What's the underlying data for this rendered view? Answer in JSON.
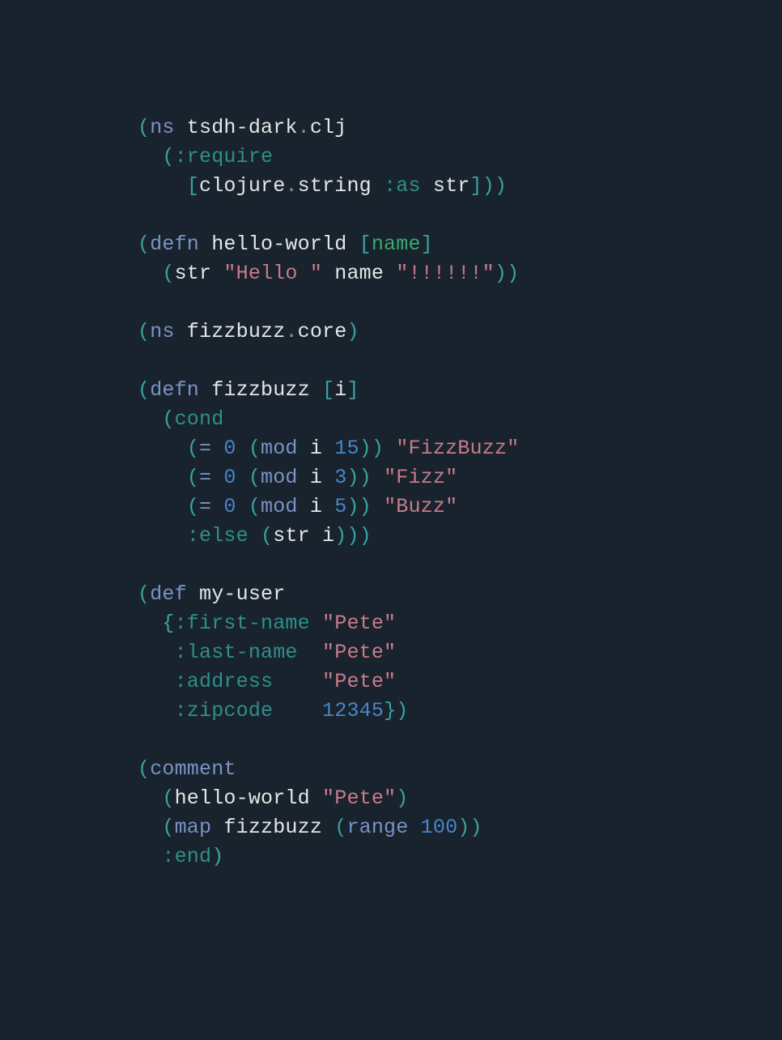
{
  "theme": {
    "bg": "#18232e",
    "fg": "#e6e6e6",
    "paren": "#3aa39f",
    "bracket": "#3aa39f",
    "brace": "#3aa39f",
    "keyword_builtin": "#7b92c5",
    "keyword_teal": "#2f8f8a",
    "string": "#c97b88",
    "number": "#4a85c9",
    "symbol_green": "#3aa86e",
    "gray": "#8a9099"
  },
  "code": {
    "tokens": [
      [
        [
          "(",
          "paren"
        ],
        [
          "ns",
          "builtin"
        ],
        [
          " tsdh-dark",
          "fg"
        ],
        [
          ".",
          "gray"
        ],
        [
          "clj",
          "fg"
        ]
      ],
      [
        [
          "  ",
          "fg"
        ],
        [
          "(",
          "paren"
        ],
        [
          ":require",
          "kw"
        ]
      ],
      [
        [
          "    ",
          "fg"
        ],
        [
          "[",
          "bracket"
        ],
        [
          "clojure",
          "fg"
        ],
        [
          ".",
          "gray"
        ],
        [
          "string ",
          "fg"
        ],
        [
          ":as",
          "kw"
        ],
        [
          " str",
          "fg"
        ],
        [
          "]",
          "bracket"
        ],
        [
          ")",
          "paren"
        ],
        [
          ")",
          "paren"
        ]
      ],
      [
        [
          "",
          "fg"
        ]
      ],
      [
        [
          "(",
          "paren"
        ],
        [
          "defn",
          "builtin"
        ],
        [
          " hello-world ",
          "fg"
        ],
        [
          "[",
          "bracket"
        ],
        [
          "name",
          "green"
        ],
        [
          "]",
          "bracket"
        ]
      ],
      [
        [
          "  ",
          "fg"
        ],
        [
          "(",
          "paren"
        ],
        [
          "str ",
          "fg"
        ],
        [
          "\"Hello \"",
          "string"
        ],
        [
          " name ",
          "fg"
        ],
        [
          "\"!!!!!!\"",
          "string"
        ],
        [
          ")",
          "paren"
        ],
        [
          ")",
          "paren"
        ]
      ],
      [
        [
          "",
          "fg"
        ]
      ],
      [
        [
          "(",
          "paren"
        ],
        [
          "ns",
          "builtin"
        ],
        [
          " fizzbuzz",
          "fg"
        ],
        [
          ".",
          "gray"
        ],
        [
          "core",
          "fg"
        ],
        [
          ")",
          "paren"
        ]
      ],
      [
        [
          "",
          "fg"
        ]
      ],
      [
        [
          "(",
          "paren"
        ],
        [
          "defn",
          "builtin"
        ],
        [
          " fizzbuzz ",
          "fg"
        ],
        [
          "[",
          "bracket"
        ],
        [
          "i",
          "fg"
        ],
        [
          "]",
          "bracket"
        ]
      ],
      [
        [
          "  ",
          "fg"
        ],
        [
          "(",
          "paren"
        ],
        [
          "cond",
          "kw"
        ]
      ],
      [
        [
          "    ",
          "fg"
        ],
        [
          "(",
          "paren"
        ],
        [
          "= ",
          "builtin"
        ],
        [
          "0",
          "number"
        ],
        [
          " ",
          "fg"
        ],
        [
          "(",
          "paren"
        ],
        [
          "mod",
          "builtin"
        ],
        [
          " i ",
          "fg"
        ],
        [
          "15",
          "number"
        ],
        [
          ")",
          "paren"
        ],
        [
          ")",
          "paren"
        ],
        [
          " ",
          "fg"
        ],
        [
          "\"FizzBuzz\"",
          "string"
        ]
      ],
      [
        [
          "    ",
          "fg"
        ],
        [
          "(",
          "paren"
        ],
        [
          "= ",
          "builtin"
        ],
        [
          "0",
          "number"
        ],
        [
          " ",
          "fg"
        ],
        [
          "(",
          "paren"
        ],
        [
          "mod",
          "builtin"
        ],
        [
          " i ",
          "fg"
        ],
        [
          "3",
          "number"
        ],
        [
          ")",
          "paren"
        ],
        [
          ")",
          "paren"
        ],
        [
          " ",
          "fg"
        ],
        [
          "\"Fizz\"",
          "string"
        ]
      ],
      [
        [
          "    ",
          "fg"
        ],
        [
          "(",
          "paren"
        ],
        [
          "= ",
          "builtin"
        ],
        [
          "0",
          "number"
        ],
        [
          " ",
          "fg"
        ],
        [
          "(",
          "paren"
        ],
        [
          "mod",
          "builtin"
        ],
        [
          " i ",
          "fg"
        ],
        [
          "5",
          "number"
        ],
        [
          ")",
          "paren"
        ],
        [
          ")",
          "paren"
        ],
        [
          " ",
          "fg"
        ],
        [
          "\"Buzz\"",
          "string"
        ]
      ],
      [
        [
          "    ",
          "fg"
        ],
        [
          ":else",
          "kw"
        ],
        [
          " ",
          "fg"
        ],
        [
          "(",
          "paren"
        ],
        [
          "str ",
          "fg"
        ],
        [
          "i",
          "fg"
        ],
        [
          ")",
          "paren"
        ],
        [
          ")",
          "paren"
        ],
        [
          ")",
          "paren"
        ]
      ],
      [
        [
          "",
          "fg"
        ]
      ],
      [
        [
          "(",
          "paren"
        ],
        [
          "def",
          "builtin"
        ],
        [
          " my-user",
          "fg"
        ]
      ],
      [
        [
          "  ",
          "fg"
        ],
        [
          "{",
          "brace"
        ],
        [
          ":first-name",
          "kw"
        ],
        [
          " ",
          "fg"
        ],
        [
          "\"Pete\"",
          "string"
        ]
      ],
      [
        [
          "   ",
          "fg"
        ],
        [
          ":last-name",
          "kw"
        ],
        [
          "  ",
          "fg"
        ],
        [
          "\"Pete\"",
          "string"
        ]
      ],
      [
        [
          "   ",
          "fg"
        ],
        [
          ":address",
          "kw"
        ],
        [
          "    ",
          "fg"
        ],
        [
          "\"Pete\"",
          "string"
        ]
      ],
      [
        [
          "   ",
          "fg"
        ],
        [
          ":zipcode",
          "kw"
        ],
        [
          "    ",
          "fg"
        ],
        [
          "12345",
          "number"
        ],
        [
          "}",
          "brace"
        ],
        [
          ")",
          "paren"
        ]
      ],
      [
        [
          "",
          "fg"
        ]
      ],
      [
        [
          "(",
          "paren"
        ],
        [
          "comment",
          "builtin"
        ]
      ],
      [
        [
          "  ",
          "fg"
        ],
        [
          "(",
          "paren"
        ],
        [
          "hello-world ",
          "fg"
        ],
        [
          "\"Pete\"",
          "string"
        ],
        [
          ")",
          "paren"
        ]
      ],
      [
        [
          "  ",
          "fg"
        ],
        [
          "(",
          "paren"
        ],
        [
          "map",
          "builtin"
        ],
        [
          " fizzbuzz ",
          "fg"
        ],
        [
          "(",
          "paren"
        ],
        [
          "range ",
          "builtin"
        ],
        [
          "100",
          "number"
        ],
        [
          ")",
          "paren"
        ],
        [
          ")",
          "paren"
        ]
      ],
      [
        [
          "  ",
          "fg"
        ],
        [
          ":end",
          "kw"
        ],
        [
          ")",
          "paren"
        ]
      ]
    ]
  }
}
